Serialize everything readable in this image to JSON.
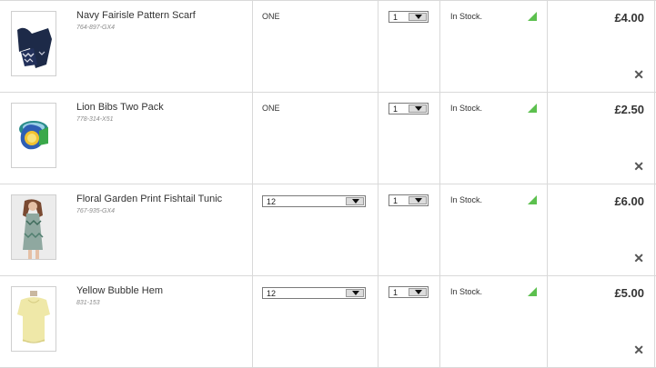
{
  "bag": {
    "items": [
      {
        "name": "Navy Fairisle Pattern Scarf",
        "code": "764-897-GX4",
        "size": "ONE",
        "size_is_select": false,
        "quantity": "1",
        "stock": "In Stock.",
        "price": "£4.00",
        "remove_label": "✕",
        "image_icon": "scarf-image"
      },
      {
        "name": "Lion Bibs Two Pack",
        "code": "778-314-X51",
        "size": "ONE",
        "size_is_select": false,
        "quantity": "1",
        "stock": "In Stock.",
        "price": "£2.50",
        "remove_label": "✕",
        "image_icon": "bibs-image"
      },
      {
        "name": "Floral Garden Print Fishtail Tunic",
        "code": "767-935-GX4",
        "size": "12",
        "size_is_select": true,
        "quantity": "1",
        "stock": "In Stock.",
        "price": "£6.00",
        "remove_label": "✕",
        "image_icon": "tunic-image"
      },
      {
        "name": "Yellow Bubble Hem",
        "code": "831-153",
        "size": "12",
        "size_is_select": true,
        "quantity": "1",
        "stock": "In Stock.",
        "price": "£5.00",
        "remove_label": "✕",
        "image_icon": "top-image"
      }
    ]
  },
  "colors": {
    "border": "#d9d9d9",
    "text": "#333333",
    "stock_flag": "#5cc04e"
  }
}
